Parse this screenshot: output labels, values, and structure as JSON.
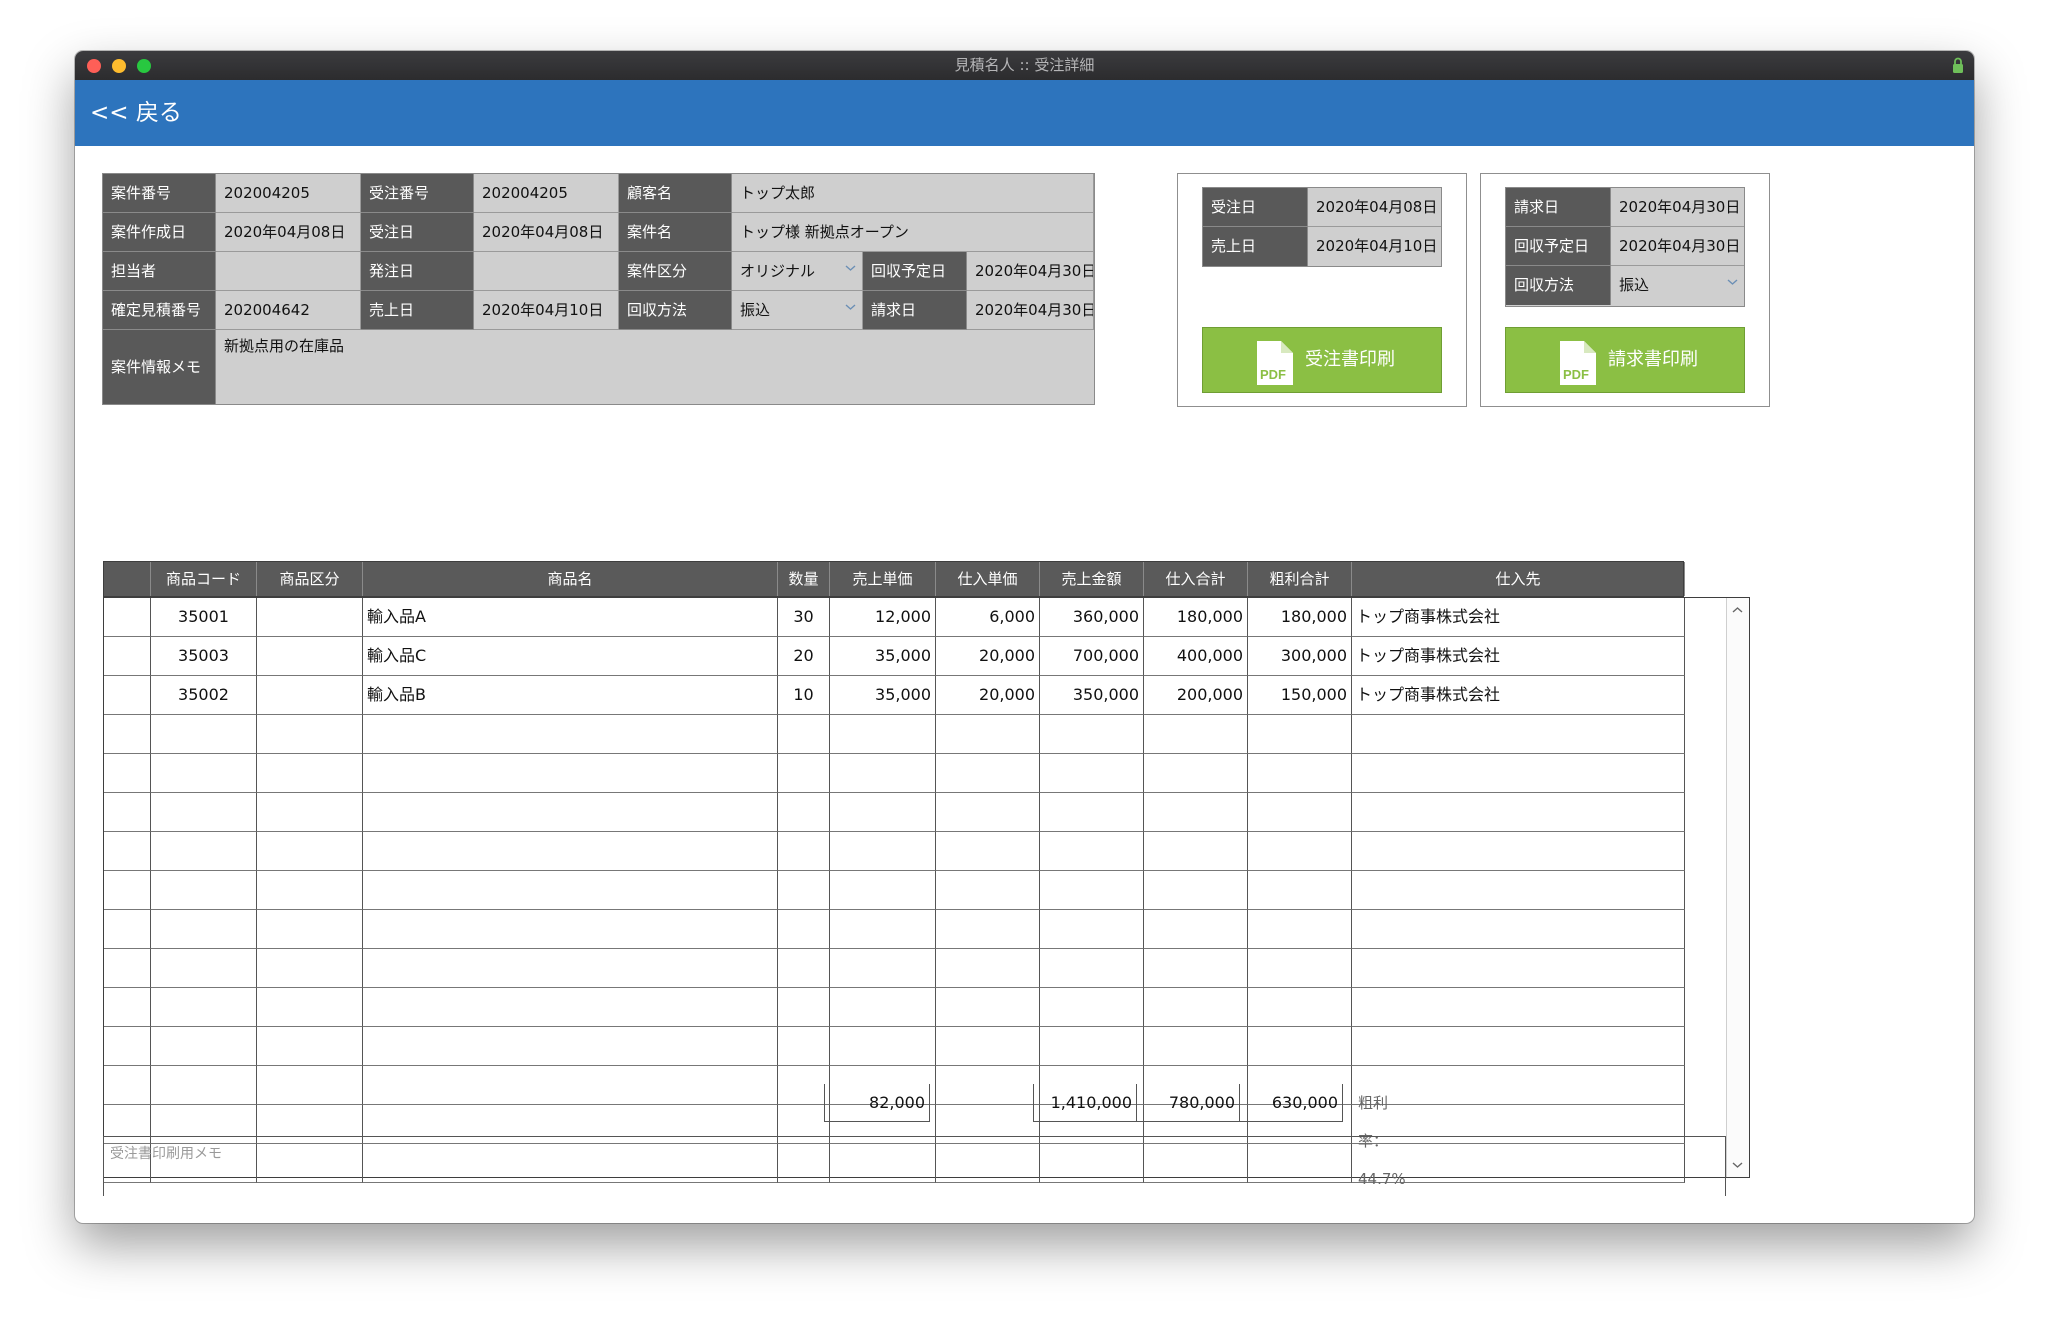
{
  "window": {
    "title": "見積名人 :: 受注詳細"
  },
  "nav": {
    "back_label": "<< 戻る"
  },
  "info": {
    "case_no_label": "案件番号",
    "case_no": "202004205",
    "order_no_label": "受注番号",
    "order_no": "202004205",
    "customer_label": "顧客名",
    "customer": "トップ太郎",
    "created_label": "案件作成日",
    "created": "2020年04月08日",
    "order_date_label": "受注日",
    "order_date": "2020年04月08日",
    "case_name_label": "案件名",
    "case_name": "トップ様 新拠点オープン",
    "staff_label": "担当者",
    "staff": "",
    "ship_label": "発注日",
    "ship": "",
    "category_label": "案件区分",
    "category": "オリジナル",
    "collect_plan_label": "回収予定日",
    "collect_plan": "2020年04月30日",
    "quote_no_label": "確定見積番号",
    "quote_no": "202004642",
    "sales_date_label": "売上日",
    "sales_date": "2020年04月10日",
    "collect_method_label": "回収方法",
    "collect_method": "振込",
    "bill_date_label": "請求日",
    "bill_date": "2020年04月30日",
    "memo_label": "案件情報メモ",
    "memo": "新拠点用の在庫品"
  },
  "order_box": {
    "order_date_label": "受注日",
    "order_date": "2020年04月08日",
    "sales_date_label": "売上日",
    "sales_date": "2020年04月10日",
    "print_label": "受注書印刷"
  },
  "invoice_box": {
    "bill_date_label": "請求日",
    "bill_date": "2020年04月30日",
    "collect_plan_label": "回収予定日",
    "collect_plan": "2020年04月30日",
    "collect_method_label": "回収方法",
    "collect_method": "振込",
    "print_label": "請求書印刷"
  },
  "pdf_icon_text": "PDF",
  "grid": {
    "headers": [
      "",
      "商品コード",
      "商品区分",
      "商品名",
      "数量",
      "売上単価",
      "仕入単価",
      "売上金額",
      "仕入合計",
      "粗利合計",
      "仕入先"
    ],
    "rows": [
      [
        "",
        "35001",
        "",
        "輸入品A",
        "30",
        "12,000",
        "6,000",
        "360,000",
        "180,000",
        "180,000",
        "トップ商事株式会社"
      ],
      [
        "",
        "35003",
        "",
        "輸入品C",
        "20",
        "35,000",
        "20,000",
        "700,000",
        "400,000",
        "300,000",
        "トップ商事株式会社"
      ],
      [
        "",
        "35002",
        "",
        "輸入品B",
        "10",
        "35,000",
        "20,000",
        "350,000",
        "200,000",
        "150,000",
        "トップ商事株式会社"
      ]
    ],
    "empty_rows": 12
  },
  "totals": {
    "unit_price_total": "82,000",
    "sales_total": "1,410,000",
    "purchase_total": "780,000",
    "profit_total": "630,000",
    "profit_ratio": "粗利率：44.7%"
  },
  "print_memo": {
    "placeholder": "受注書印刷用メモ"
  },
  "colors": {
    "nav": "#2d74bd",
    "label_bg": "#595959",
    "button": "#8bbf44"
  }
}
